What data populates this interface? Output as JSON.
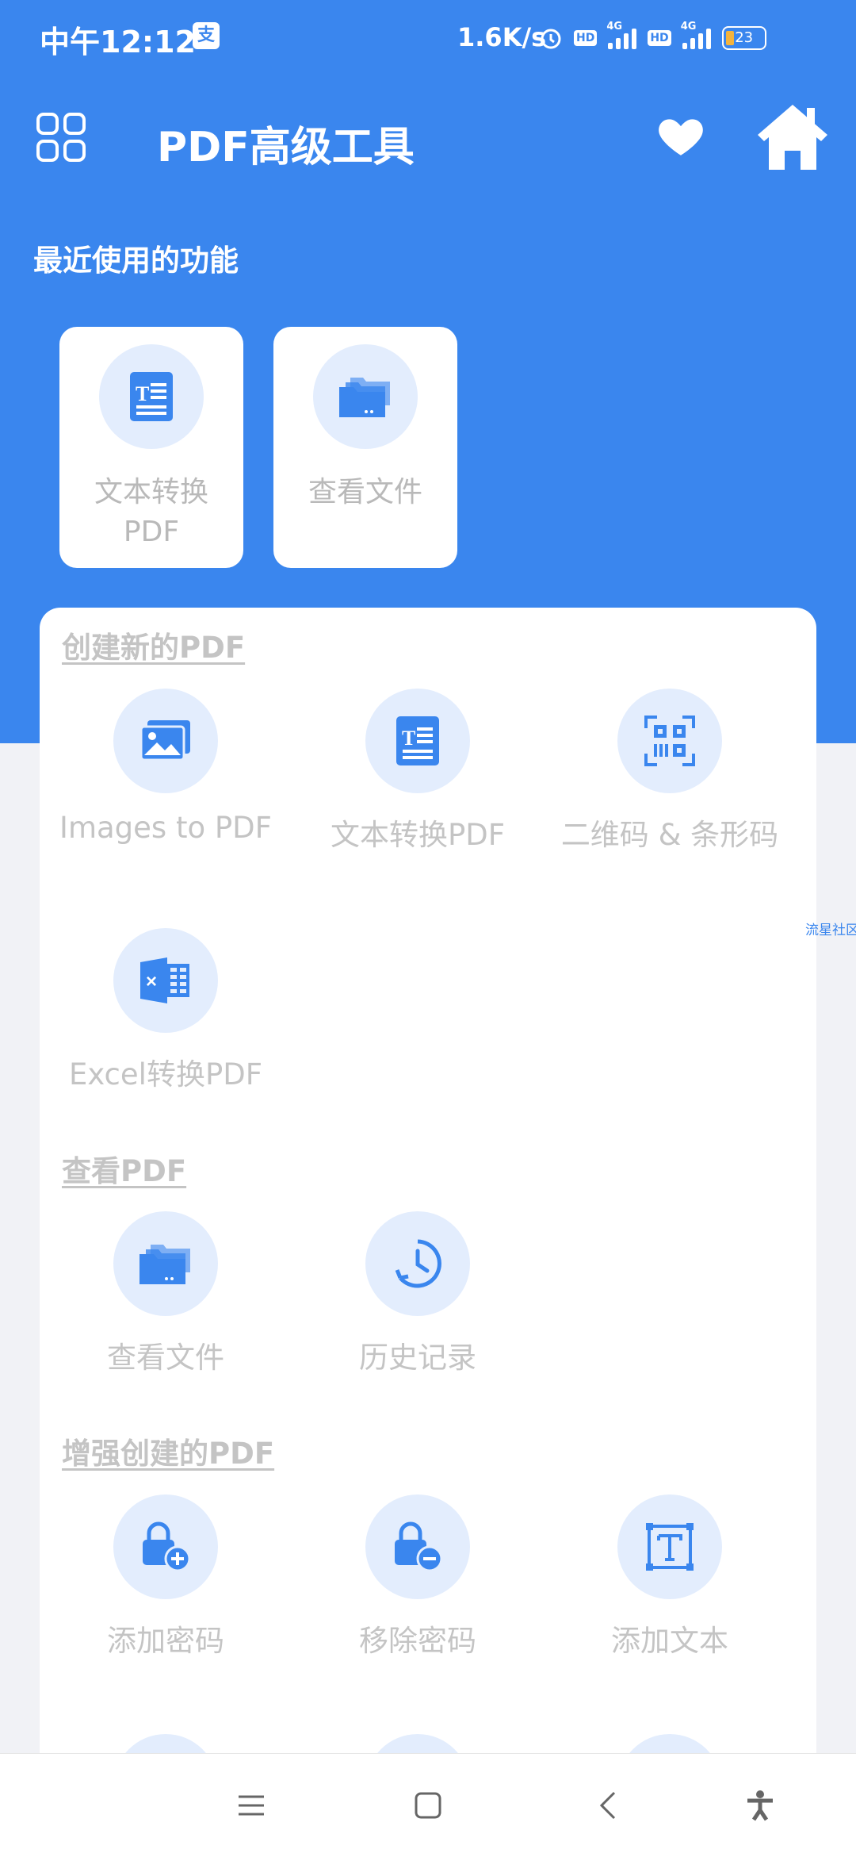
{
  "status_bar": {
    "time": "中午12:12",
    "app_badge": "支",
    "net_speed": "1.6K/s",
    "hd1": "HD",
    "sig1_tag": "4G",
    "hd2": "HD",
    "sig2_tag": "4G",
    "battery": "23"
  },
  "header": {
    "title": "PDF高级工具"
  },
  "recent": {
    "label": "最近使用的功能",
    "items": [
      {
        "label": "文本转换PDF",
        "icon": "text-document-icon"
      },
      {
        "label": "查看文件",
        "icon": "folder-icon"
      }
    ]
  },
  "sections": {
    "create": {
      "title": "创建新的PDF",
      "items": [
        {
          "label": "Images to PDF",
          "icon": "images-icon"
        },
        {
          "label": "文本转换PDF",
          "icon": "text-document-icon"
        },
        {
          "label": "二维码 & 条形码",
          "icon": "qr-code-icon"
        },
        {
          "label": "Excel转换PDF",
          "icon": "excel-icon"
        }
      ]
    },
    "view": {
      "title": "查看PDF",
      "items": [
        {
          "label": "查看文件",
          "icon": "folder-icon"
        },
        {
          "label": "历史记录",
          "icon": "history-icon"
        }
      ]
    },
    "enhance": {
      "title": "增强创建的PDF",
      "items": [
        {
          "label": "添加密码",
          "icon": "lock-add-icon"
        },
        {
          "label": "移除密码",
          "icon": "lock-remove-icon"
        },
        {
          "label": "添加文本",
          "icon": "add-text-icon"
        }
      ]
    }
  },
  "side_link": "流星社区",
  "colors": {
    "primary": "#3a86ee",
    "icon_bg": "#e3edfd",
    "muted_text": "#c4c4c4"
  }
}
